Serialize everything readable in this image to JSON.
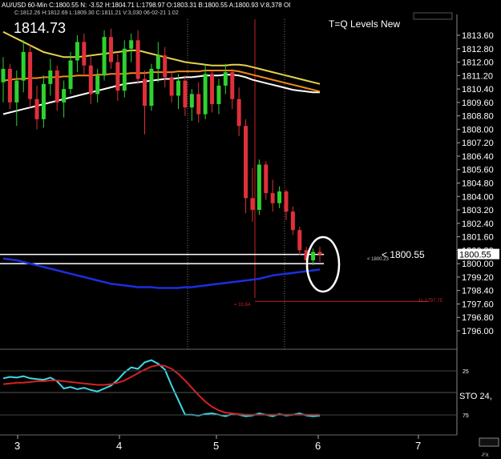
{
  "header": {
    "symbol_bar": "AU/USD 60-Min  C:1800.55  N: -3.52  H:1804.71  L:1798.97  O:1803.31  B:1800.55  A:1800.93  V:8,378  OI",
    "sub_bar": "C:1812.26  H:1812.69  L:1809.30  C:1811.21  V:3,030  06-02-21  1.02",
    "big_price": "1814.73",
    "study_title": "T=Q Levels New",
    "corner_label": "-FX"
  },
  "annotations": {
    "price_callout": "< 1800.55",
    "price_callout_small": "< 1800.23",
    "low_label": "1L 1797.75",
    "range_label": "= 33.64"
  },
  "colors": {
    "background": "#000000",
    "up_candle": "#2fd12f",
    "down_candle": "#e0303a",
    "ma_white": "#ffffff",
    "ma_orange": "#f08a1a",
    "ma_yellow": "#e6d24a",
    "ma_blue": "#1a2fe0",
    "stoch_k": "#3fd8e8",
    "stoch_d": "#d42222",
    "highlight_circle": "#ffffff",
    "grid": "#555555"
  },
  "chart_data": [
    {
      "type": "line",
      "title": "",
      "xlabel": "",
      "ylabel": "",
      "x_ticks": [
        "3",
        "4",
        "5",
        "6",
        "7"
      ],
      "ylim": [
        1795.0,
        1814.5
      ],
      "y_ticks": [
        "1813.60",
        "1812.80",
        "1812.00",
        "1811.20",
        "1810.40",
        "1809.60",
        "1808.80",
        "1808.00",
        "1807.20",
        "1806.40",
        "1805.60",
        "1804.80",
        "1804.00",
        "1803.20",
        "1802.40",
        "1801.60",
        "1800.80",
        "1800.00",
        "1799.20",
        "1798.40",
        "1797.60",
        "1796.80",
        "1796.00"
      ],
      "last_price_label": "1800.55",
      "candles": [
        {
          "o": 1810.8,
          "h": 1812.3,
          "l": 1809.6,
          "c": 1811.6
        },
        {
          "o": 1811.6,
          "h": 1811.9,
          "l": 1809.2,
          "c": 1809.6
        },
        {
          "o": 1809.6,
          "h": 1811.5,
          "l": 1808.2,
          "c": 1810.9
        },
        {
          "o": 1810.9,
          "h": 1813.3,
          "l": 1810.2,
          "c": 1812.6
        },
        {
          "o": 1812.6,
          "h": 1813.0,
          "l": 1809.3,
          "c": 1809.8
        },
        {
          "o": 1809.8,
          "h": 1810.6,
          "l": 1808.0,
          "c": 1808.6
        },
        {
          "o": 1808.6,
          "h": 1811.2,
          "l": 1808.1,
          "c": 1810.7
        },
        {
          "o": 1810.7,
          "h": 1812.2,
          "l": 1810.0,
          "c": 1811.5
        },
        {
          "o": 1811.5,
          "h": 1811.8,
          "l": 1809.1,
          "c": 1809.6
        },
        {
          "o": 1809.6,
          "h": 1810.9,
          "l": 1808.7,
          "c": 1810.4
        },
        {
          "o": 1810.4,
          "h": 1812.6,
          "l": 1810.1,
          "c": 1812.1
        },
        {
          "o": 1812.1,
          "h": 1813.6,
          "l": 1811.4,
          "c": 1813.2
        },
        {
          "o": 1813.2,
          "h": 1813.7,
          "l": 1811.2,
          "c": 1811.8
        },
        {
          "o": 1811.8,
          "h": 1812.4,
          "l": 1809.5,
          "c": 1810.1
        },
        {
          "o": 1810.1,
          "h": 1811.6,
          "l": 1809.6,
          "c": 1811.2
        },
        {
          "o": 1811.2,
          "h": 1813.9,
          "l": 1810.9,
          "c": 1813.5
        },
        {
          "o": 1813.5,
          "h": 1814.0,
          "l": 1811.6,
          "c": 1812.0
        },
        {
          "o": 1812.0,
          "h": 1812.5,
          "l": 1809.7,
          "c": 1810.3
        },
        {
          "o": 1810.3,
          "h": 1813.3,
          "l": 1809.9,
          "c": 1812.8
        },
        {
          "o": 1812.8,
          "h": 1813.7,
          "l": 1812.0,
          "c": 1813.3
        },
        {
          "o": 1813.3,
          "h": 1813.9,
          "l": 1810.7,
          "c": 1811.0
        },
        {
          "o": 1811.0,
          "h": 1811.5,
          "l": 1807.7,
          "c": 1809.4
        },
        {
          "o": 1809.4,
          "h": 1811.9,
          "l": 1809.1,
          "c": 1811.6
        },
        {
          "o": 1811.6,
          "h": 1813.2,
          "l": 1810.8,
          "c": 1812.4
        },
        {
          "o": 1812.4,
          "h": 1812.9,
          "l": 1810.5,
          "c": 1811.1
        },
        {
          "o": 1811.1,
          "h": 1811.4,
          "l": 1809.6,
          "c": 1810.0
        },
        {
          "o": 1810.0,
          "h": 1811.3,
          "l": 1809.2,
          "c": 1810.9
        },
        {
          "o": 1810.9,
          "h": 1811.2,
          "l": 1808.8,
          "c": 1809.3
        },
        {
          "o": 1809.3,
          "h": 1810.4,
          "l": 1808.5,
          "c": 1810.1
        },
        {
          "o": 1810.1,
          "h": 1810.8,
          "l": 1808.4,
          "c": 1808.9
        },
        {
          "o": 1808.9,
          "h": 1811.8,
          "l": 1808.6,
          "c": 1811.3
        },
        {
          "o": 1811.3,
          "h": 1811.5,
          "l": 1809.0,
          "c": 1809.5
        },
        {
          "o": 1809.5,
          "h": 1811.0,
          "l": 1808.9,
          "c": 1810.6
        },
        {
          "o": 1810.6,
          "h": 1811.9,
          "l": 1810.1,
          "c": 1811.4
        },
        {
          "o": 1811.4,
          "h": 1811.6,
          "l": 1809.2,
          "c": 1809.8
        },
        {
          "o": 1809.8,
          "h": 1810.5,
          "l": 1807.6,
          "c": 1808.2
        },
        {
          "o": 1808.2,
          "h": 1808.6,
          "l": 1803.0,
          "c": 1803.9
        },
        {
          "o": 1803.9,
          "h": 1805.7,
          "l": 1802.5,
          "c": 1803.2
        },
        {
          "o": 1803.2,
          "h": 1806.2,
          "l": 1802.9,
          "c": 1805.9
        },
        {
          "o": 1805.9,
          "h": 1806.1,
          "l": 1803.8,
          "c": 1804.2
        },
        {
          "o": 1804.2,
          "h": 1805.0,
          "l": 1803.1,
          "c": 1803.6
        },
        {
          "o": 1803.6,
          "h": 1804.6,
          "l": 1803.3,
          "c": 1804.3
        },
        {
          "o": 1804.3,
          "h": 1804.4,
          "l": 1802.6,
          "c": 1803.1
        },
        {
          "o": 1803.1,
          "h": 1803.4,
          "l": 1801.7,
          "c": 1802.0
        },
        {
          "o": 1802.0,
          "h": 1802.2,
          "l": 1800.5,
          "c": 1800.8
        },
        {
          "o": 1800.8,
          "h": 1801.0,
          "l": 1799.6,
          "c": 1800.2
        },
        {
          "o": 1800.2,
          "h": 1800.9,
          "l": 1799.9,
          "c": 1800.7
        },
        {
          "o": 1800.7,
          "h": 1801.0,
          "l": 1800.1,
          "c": 1800.55
        }
      ],
      "series": [
        {
          "color": "#ffffff",
          "values": [
            1808.9,
            1809.0,
            1809.1,
            1809.2,
            1809.3,
            1809.4,
            1809.5,
            1809.6,
            1809.7,
            1809.8,
            1809.9,
            1810.0,
            1810.1,
            1810.2,
            1810.3,
            1810.4,
            1810.5,
            1810.6,
            1810.7,
            1810.75,
            1810.8,
            1810.85,
            1810.9,
            1810.95,
            1811.0,
            1811.0,
            1811.05,
            1811.1,
            1811.1,
            1811.15,
            1811.2,
            1811.2,
            1811.2,
            1811.25,
            1811.25,
            1811.2,
            1811.1,
            1810.95,
            1810.85,
            1810.75,
            1810.65,
            1810.55,
            1810.45,
            1810.35,
            1810.3,
            1810.25,
            1810.2,
            1810.2
          ]
        },
        {
          "color": "#f08a1a",
          "values": [
            1810.9,
            1810.95,
            1811.0,
            1811.0,
            1811.05,
            1811.05,
            1811.1,
            1811.1,
            1811.1,
            1811.15,
            1811.15,
            1811.2,
            1811.2,
            1811.2,
            1811.25,
            1811.25,
            1811.3,
            1811.3,
            1811.3,
            1811.35,
            1811.35,
            1811.35,
            1811.4,
            1811.4,
            1811.4,
            1811.4,
            1811.45,
            1811.45,
            1811.45,
            1811.45,
            1811.5,
            1811.5,
            1811.5,
            1811.5,
            1811.5,
            1811.45,
            1811.35,
            1811.25,
            1811.15,
            1811.05,
            1810.95,
            1810.85,
            1810.75,
            1810.65,
            1810.55,
            1810.45,
            1810.35,
            1810.25
          ]
        },
        {
          "color": "#e6d24a",
          "values": [
            1813.8,
            1813.6,
            1813.4,
            1813.2,
            1813.0,
            1812.8,
            1812.6,
            1812.5,
            1812.4,
            1812.3,
            1812.3,
            1812.3,
            1812.35,
            1812.4,
            1812.45,
            1812.5,
            1812.55,
            1812.6,
            1812.65,
            1812.7,
            1812.7,
            1812.6,
            1812.5,
            1812.4,
            1812.3,
            1812.2,
            1812.1,
            1812.0,
            1811.95,
            1811.9,
            1811.85,
            1811.8,
            1811.8,
            1811.8,
            1811.85,
            1811.85,
            1811.8,
            1811.7,
            1811.6,
            1811.5,
            1811.4,
            1811.3,
            1811.2,
            1811.1,
            1811.0,
            1810.9,
            1810.8,
            1810.7
          ]
        },
        {
          "color": "#1a2fe0",
          "values": [
            1800.3,
            1800.25,
            1800.2,
            1800.1,
            1800.0,
            1799.9,
            1799.8,
            1799.7,
            1799.6,
            1799.5,
            1799.4,
            1799.3,
            1799.2,
            1799.1,
            1799.0,
            1798.9,
            1798.8,
            1798.75,
            1798.7,
            1798.65,
            1798.6,
            1798.6,
            1798.6,
            1798.55,
            1798.55,
            1798.55,
            1798.55,
            1798.6,
            1798.6,
            1798.65,
            1798.7,
            1798.75,
            1798.8,
            1798.85,
            1798.9,
            1798.95,
            1799.0,
            1799.05,
            1799.1,
            1799.2,
            1799.3,
            1799.35,
            1799.4,
            1799.45,
            1799.5,
            1799.55,
            1799.6,
            1799.65
          ]
        }
      ],
      "horizontal_lines": [
        1800.55,
        1800.0
      ],
      "low_line": 1797.75
    },
    {
      "type": "line",
      "title": "",
      "ylim": [
        0,
        100
      ],
      "y_ticks": [
        "25",
        "75"
      ],
      "legend_label": "STO 24,",
      "series": [
        {
          "color": "#3fd8e8",
          "values": [
            70,
            72,
            71,
            73,
            70,
            69,
            68,
            71,
            66,
            56,
            58,
            55,
            57,
            54,
            52,
            56,
            60,
            68,
            78,
            85,
            83,
            92,
            95,
            90,
            82,
            60,
            40,
            20,
            20,
            19,
            21,
            22,
            20,
            18,
            21,
            20,
            18,
            19,
            22,
            20,
            18,
            21,
            19,
            20,
            22,
            19,
            18,
            19
          ]
        },
        {
          "color": "#d42222",
          "values": [
            62,
            63,
            64,
            64,
            65,
            66,
            66,
            67,
            67,
            66,
            65,
            64,
            63,
            62,
            61,
            61,
            62,
            64,
            67,
            72,
            77,
            82,
            86,
            88,
            87,
            83,
            76,
            67,
            57,
            47,
            38,
            31,
            26,
            23,
            22,
            21,
            20,
            20,
            20,
            20,
            20,
            20,
            20,
            20,
            20,
            20,
            20,
            20
          ]
        }
      ]
    }
  ]
}
